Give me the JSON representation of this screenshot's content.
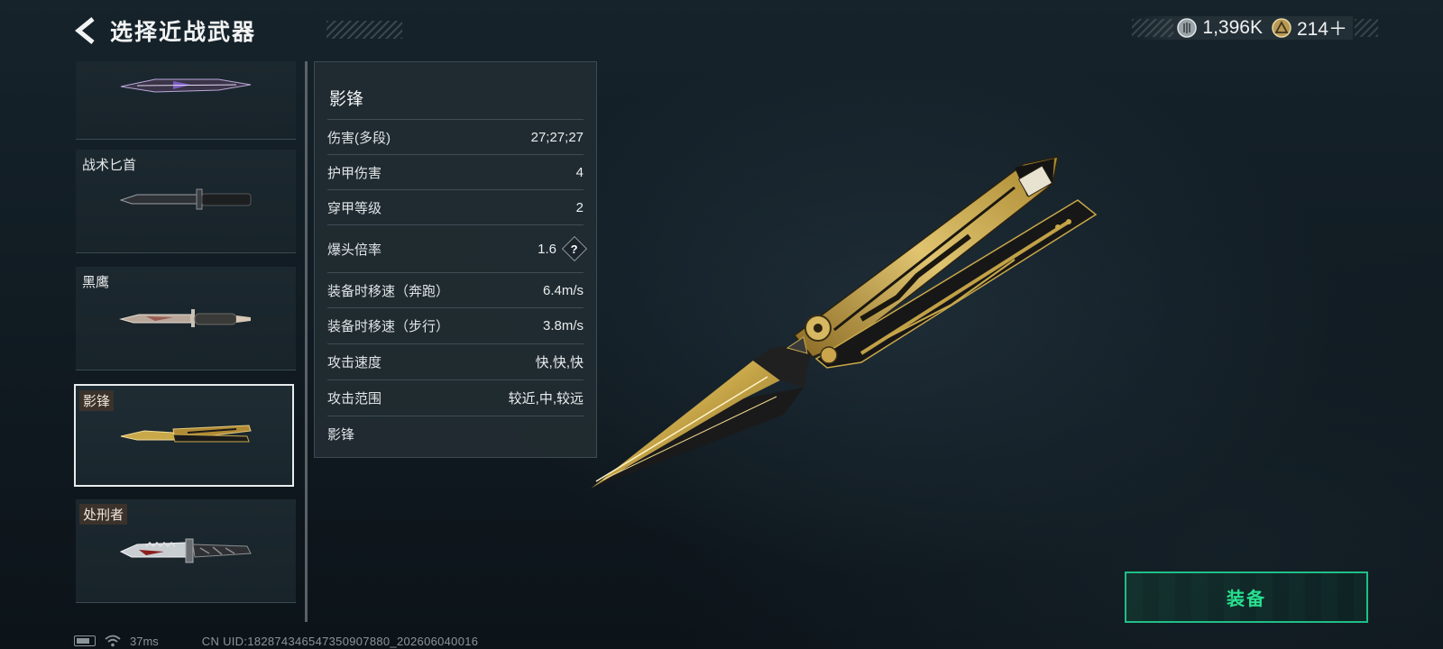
{
  "header": {
    "title": "选择近战武器",
    "back_icon": "chevron-left-icon"
  },
  "currency": [
    {
      "icon": "silver-coin-icon",
      "value": "1,396K"
    },
    {
      "icon": "gold-triangle-coin-icon",
      "value": "214＋"
    }
  ],
  "weapon_list": [
    {
      "name": "",
      "selected": false
    },
    {
      "name": "战术匕首",
      "selected": false
    },
    {
      "name": "黑鹰",
      "selected": false
    },
    {
      "name": "影锋",
      "selected": true
    },
    {
      "name": "处刑者",
      "selected": false
    }
  ],
  "stats": {
    "title": "影锋",
    "rows": [
      {
        "label": "伤害(多段)",
        "value": "27;27;27"
      },
      {
        "label": "护甲伤害",
        "value": "4"
      },
      {
        "label": "穿甲等级",
        "value": "2"
      },
      {
        "label": "爆头倍率",
        "value": "1.6",
        "help": "?"
      },
      {
        "label": "装备时移速（奔跑）",
        "value": "6.4m/s"
      },
      {
        "label": "装备时移速（步行）",
        "value": "3.8m/s"
      },
      {
        "label": "攻击速度",
        "value": "快,快,快"
      },
      {
        "label": "攻击范围",
        "value": "较近,中,较远"
      }
    ],
    "footer": "影锋"
  },
  "equip_button": {
    "label": "装备"
  },
  "status_bar": {
    "ping": "37ms",
    "uid": "CN UID:182874346547350907880_202606040016"
  },
  "colors": {
    "accent_green": "#27e08f",
    "gold": "#c9a84a",
    "panel_bg": "#222c32"
  }
}
